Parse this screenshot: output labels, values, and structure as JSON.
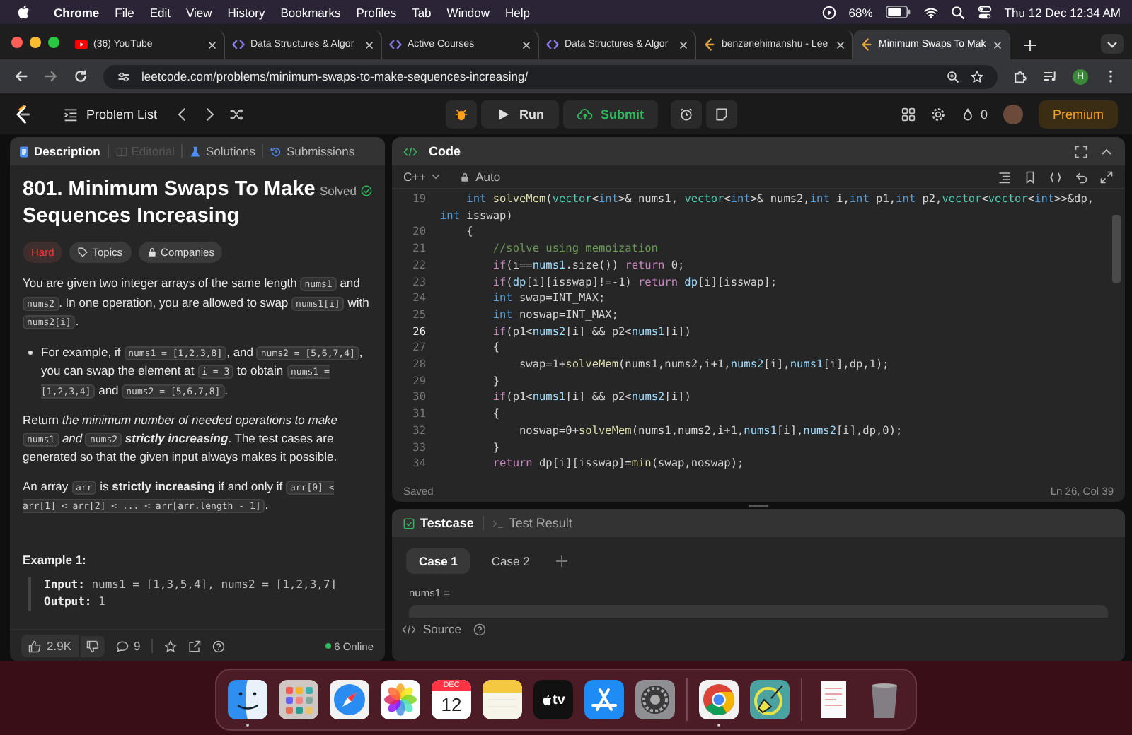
{
  "menu_bar": {
    "app": "Chrome",
    "items": [
      "File",
      "Edit",
      "View",
      "History",
      "Bookmarks",
      "Profiles",
      "Tab",
      "Window",
      "Help"
    ],
    "battery": "68%",
    "clock": "Thu 12 Dec  12:34 AM"
  },
  "browser_tabs": [
    {
      "title": "(36) YouTube",
      "kind": "youtube",
      "selected": false
    },
    {
      "title": "Data Structures & Algor",
      "kind": "course",
      "selected": false
    },
    {
      "title": "Active Courses",
      "kind": "course",
      "selected": false
    },
    {
      "title": "Data Structures & Algor",
      "kind": "course",
      "selected": false
    },
    {
      "title": "benzenehimanshu - Lee",
      "kind": "leetcode",
      "selected": false
    },
    {
      "title": "Minimum Swaps To Mak",
      "kind": "leetcode",
      "selected": true
    }
  ],
  "address_bar": {
    "url": "leetcode.com/problems/minimum-swaps-to-make-sequences-increasing/",
    "profile_initial": "H"
  },
  "toolbar": {
    "problem_list": "Problem List",
    "run": "Run",
    "submit": "Submit",
    "streak": "0",
    "premium": "Premium"
  },
  "description_panel": {
    "tabs": [
      {
        "label": "Description",
        "kind": "description",
        "selected": true,
        "disabled": false
      },
      {
        "label": "Editorial",
        "kind": "editorial",
        "selected": false,
        "disabled": true
      },
      {
        "label": "Solutions",
        "kind": "solutions",
        "selected": false,
        "disabled": false
      },
      {
        "label": "Submissions",
        "kind": "submissions",
        "selected": false,
        "disabled": false
      }
    ],
    "title": "801. Minimum Swaps To Make Sequences Increasing",
    "status": "Solved",
    "tags": [
      {
        "label": "Hard",
        "kind": "difficulty"
      },
      {
        "label": "Topics",
        "kind": "topics"
      },
      {
        "label": "Companies",
        "kind": "companies"
      }
    ],
    "paragraphs": [
      {
        "kind": "paragraph",
        "segments": [
          {
            "text": "You are given two integer arrays of the same length "
          },
          {
            "text": "nums1",
            "kind": "code"
          },
          {
            "text": " and "
          },
          {
            "text": "nums2",
            "kind": "code"
          },
          {
            "text": ". In one operation, you are allowed to swap "
          },
          {
            "text": "nums1[i]",
            "kind": "code"
          },
          {
            "text": " with "
          },
          {
            "text": "nums2[i]",
            "kind": "code"
          },
          {
            "text": "."
          }
        ]
      },
      {
        "kind": "bullet",
        "segments": [
          {
            "text": "For example, if "
          },
          {
            "text": "nums1 = [1,2,3,8]",
            "kind": "code"
          },
          {
            "text": ", and "
          },
          {
            "text": "nums2 = [5,6,7,4]",
            "kind": "code"
          },
          {
            "text": ", you can swap the element at "
          },
          {
            "text": "i = 3",
            "kind": "code"
          },
          {
            "text": " to obtain "
          },
          {
            "text": "nums1 = [1,2,3,4]",
            "kind": "code"
          },
          {
            "text": " and "
          },
          {
            "text": "nums2 = [5,6,7,8]",
            "kind": "code"
          },
          {
            "text": "."
          }
        ]
      },
      {
        "kind": "paragraph",
        "segments": [
          {
            "text": "Return "
          },
          {
            "text": "the minimum number of needed operations to make ",
            "kind": "italic"
          },
          {
            "text": "nums1",
            "kind": "code"
          },
          {
            "text": " and ",
            "kind": "italic"
          },
          {
            "text": "nums2",
            "kind": "code"
          },
          {
            "text": " strictly increasing",
            "kind": "bold-italic"
          },
          {
            "text": ". The test cases are generated so that the given input always makes it possible."
          }
        ]
      },
      {
        "kind": "paragraph",
        "segments": [
          {
            "text": "An array "
          },
          {
            "text": "arr",
            "kind": "code"
          },
          {
            "text": " is "
          },
          {
            "text": "strictly increasing",
            "kind": "bold"
          },
          {
            "text": " if and only if "
          },
          {
            "text": "arr[0] < arr[1] < arr[2] < ... < arr[arr.length - 1]",
            "kind": "code"
          },
          {
            "text": "."
          }
        ]
      }
    ],
    "example": {
      "heading": "Example 1:",
      "lines": [
        {
          "label": "Input:",
          "value": "nums1 = [1,3,5,4], nums2 = [1,2,3,7]"
        },
        {
          "label": "Output:",
          "value": "1"
        }
      ]
    },
    "footer": {
      "likes": "2.9K",
      "comments": "9",
      "online": "6 Online"
    }
  },
  "code_panel": {
    "title": "Code",
    "language": "C++",
    "mode": "Auto",
    "save_status": "Saved",
    "cursor": "Ln 26, Col 39",
    "lines": [
      {
        "number": "19",
        "current": false,
        "tokens": [
          {
            "text": "    int",
            "kind": "type"
          },
          {
            "text": " solveMem",
            "kind": "fn"
          },
          {
            "text": "("
          },
          {
            "text": "vector",
            "kind": "class"
          },
          {
            "text": "<"
          },
          {
            "text": "int",
            "kind": "type"
          },
          {
            "text": ">& nums1, "
          },
          {
            "text": "vector",
            "kind": "class"
          },
          {
            "text": "<"
          },
          {
            "text": "int",
            "kind": "type"
          },
          {
            "text": ">& nums2,"
          },
          {
            "text": "int",
            "kind": "type"
          },
          {
            "text": " i,"
          },
          {
            "text": "int",
            "kind": "type"
          },
          {
            "text": " p1,"
          },
          {
            "text": "int",
            "kind": "type"
          },
          {
            "text": " p2,"
          },
          {
            "text": "vector",
            "kind": "class"
          },
          {
            "text": "<"
          },
          {
            "text": "vector",
            "kind": "class"
          },
          {
            "text": "<"
          },
          {
            "text": "int",
            "kind": "type"
          },
          {
            "text": ">>&dp, "
          },
          {
            "text": "int",
            "kind": "type"
          },
          {
            "text": " isswap)"
          }
        ]
      },
      {
        "number": "20",
        "current": false,
        "tokens": [
          {
            "text": "    {"
          }
        ]
      },
      {
        "number": "21",
        "current": false,
        "tokens": [
          {
            "text": "        //solve using memoization",
            "kind": "comment"
          }
        ]
      },
      {
        "number": "22",
        "current": false,
        "tokens": [
          {
            "text": "        if",
            "kind": "keyword"
          },
          {
            "text": "(i=="
          },
          {
            "text": "nums1",
            "kind": "var"
          },
          {
            "text": ".size()) "
          },
          {
            "text": "return",
            "kind": "keyword"
          },
          {
            "text": " 0;"
          }
        ]
      },
      {
        "number": "23",
        "current": false,
        "tokens": [
          {
            "text": "        if",
            "kind": "keyword"
          },
          {
            "text": "("
          },
          {
            "text": "dp",
            "kind": "var"
          },
          {
            "text": "[i][isswap]!=-1) "
          },
          {
            "text": "return",
            "kind": "keyword"
          },
          {
            "text": " dp",
            "kind": "var"
          },
          {
            "text": "[i][isswap];"
          }
        ]
      },
      {
        "number": "24",
        "current": false,
        "tokens": [
          {
            "text": "        int",
            "kind": "type"
          },
          {
            "text": " swap=INT_MAX;"
          }
        ]
      },
      {
        "number": "25",
        "current": false,
        "tokens": [
          {
            "text": "        int",
            "kind": "type"
          },
          {
            "text": " noswap=INT_MAX;"
          }
        ]
      },
      {
        "number": "26",
        "current": true,
        "tokens": [
          {
            "text": "        if",
            "kind": "keyword"
          },
          {
            "text": "(p1<"
          },
          {
            "text": "nums2",
            "kind": "var"
          },
          {
            "text": "[i] && p2<"
          },
          {
            "text": "nums1",
            "kind": "var"
          },
          {
            "text": "[i])"
          }
        ]
      },
      {
        "number": "27",
        "current": false,
        "tokens": [
          {
            "text": "        {"
          }
        ]
      },
      {
        "number": "28",
        "current": false,
        "tokens": [
          {
            "text": "            swap=1+"
          },
          {
            "text": "solveMem",
            "kind": "fn"
          },
          {
            "text": "(nums1,nums2,i+1,"
          },
          {
            "text": "nums2",
            "kind": "var"
          },
          {
            "text": "[i],"
          },
          {
            "text": "nums1",
            "kind": "var"
          },
          {
            "text": "[i],dp,1);"
          }
        ]
      },
      {
        "number": "29",
        "current": false,
        "tokens": [
          {
            "text": "        }"
          }
        ]
      },
      {
        "number": "30",
        "current": false,
        "tokens": [
          {
            "text": "        if",
            "kind": "keyword"
          },
          {
            "text": "(p1<"
          },
          {
            "text": "nums1",
            "kind": "var"
          },
          {
            "text": "[i] && p2<"
          },
          {
            "text": "nums2",
            "kind": "var"
          },
          {
            "text": "[i])"
          }
        ]
      },
      {
        "number": "31",
        "current": false,
        "tokens": [
          {
            "text": "        {"
          }
        ]
      },
      {
        "number": "32",
        "current": false,
        "tokens": [
          {
            "text": "            noswap=0+"
          },
          {
            "text": "solveMem",
            "kind": "fn"
          },
          {
            "text": "(nums1,nums2,i+1,"
          },
          {
            "text": "nums1",
            "kind": "var"
          },
          {
            "text": "[i],"
          },
          {
            "text": "nums2",
            "kind": "var"
          },
          {
            "text": "[i],dp,0);"
          }
        ]
      },
      {
        "number": "33",
        "current": false,
        "tokens": [
          {
            "text": "        }"
          }
        ]
      },
      {
        "number": "34",
        "current": false,
        "tokens": [
          {
            "text": "        return",
            "kind": "keyword"
          },
          {
            "text": " dp[i][isswap]="
          },
          {
            "text": "min",
            "kind": "fn"
          },
          {
            "text": "(swap,noswap);"
          }
        ]
      }
    ]
  },
  "testcase_panel": {
    "tabs": [
      {
        "label": "Testcase",
        "kind": "testcase",
        "selected": true
      },
      {
        "label": "Test Result",
        "kind": "result",
        "selected": false
      }
    ],
    "cases": [
      {
        "label": "Case 1",
        "selected": true
      },
      {
        "label": "Case 2",
        "selected": false
      }
    ],
    "param_label": "nums1 =",
    "source": "Source"
  },
  "dock": {
    "items": [
      {
        "kind": "finder",
        "running": true
      },
      {
        "kind": "launchpad",
        "running": false
      },
      {
        "kind": "safari",
        "running": false
      },
      {
        "kind": "photos",
        "running": false
      },
      {
        "kind": "calendar",
        "month": "DEC",
        "day": "12",
        "running": false
      },
      {
        "kind": "notes",
        "running": false
      },
      {
        "kind": "tv",
        "label": "tv",
        "running": false
      },
      {
        "kind": "appstore",
        "running": false
      },
      {
        "kind": "settings",
        "running": false
      },
      {
        "kind": "divider"
      },
      {
        "kind": "chrome",
        "running": true
      },
      {
        "kind": "broom",
        "running": false
      },
      {
        "kind": "divider"
      },
      {
        "kind": "document",
        "running": false
      },
      {
        "kind": "trash",
        "running": false
      }
    ]
  }
}
